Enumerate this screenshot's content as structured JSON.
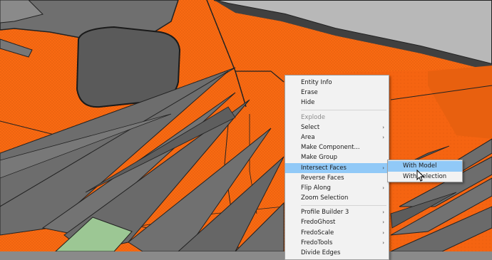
{
  "context_menu": {
    "items": [
      {
        "label": "Entity Info",
        "enabled": true,
        "submenu": false
      },
      {
        "label": "Erase",
        "enabled": true,
        "submenu": false
      },
      {
        "label": "Hide",
        "enabled": true,
        "submenu": false
      },
      {
        "label": "Explode",
        "enabled": false,
        "submenu": false
      },
      {
        "label": "Select",
        "enabled": true,
        "submenu": true
      },
      {
        "label": "Area",
        "enabled": true,
        "submenu": true
      },
      {
        "label": "Make Component...",
        "enabled": true,
        "submenu": false
      },
      {
        "label": "Make Group",
        "enabled": true,
        "submenu": false
      },
      {
        "label": "Intersect Faces",
        "enabled": true,
        "submenu": true,
        "highlighted": true
      },
      {
        "label": "Reverse Faces",
        "enabled": true,
        "submenu": false
      },
      {
        "label": "Flip Along",
        "enabled": true,
        "submenu": true
      },
      {
        "label": "Zoom Selection",
        "enabled": true,
        "submenu": false
      },
      {
        "label": "Profile Builder 3",
        "enabled": true,
        "submenu": true
      },
      {
        "label": "FredoGhost",
        "enabled": true,
        "submenu": true
      },
      {
        "label": "FredoScale",
        "enabled": true,
        "submenu": true
      },
      {
        "label": "FredoTools",
        "enabled": true,
        "submenu": true
      },
      {
        "label": "Divide Edges",
        "enabled": true,
        "submenu": false
      }
    ],
    "submenu_arrow": "›"
  },
  "submenu": {
    "items": [
      {
        "label": "With Model",
        "highlighted": true
      },
      {
        "label": "With Selection",
        "highlighted": false
      }
    ]
  },
  "colors": {
    "orange_face": "#f96a12",
    "gray_face": "#737373",
    "light_gray_face": "#b9b9b9",
    "dark_face": "#4a4a4a",
    "green_face": "#9cc794",
    "edge": "#222222",
    "menu_bg": "#f2f2f2",
    "menu_highlight": "#91c9f7"
  },
  "icons": [
    "mouse-pointer-icon",
    "submenu-arrow-icon"
  ]
}
